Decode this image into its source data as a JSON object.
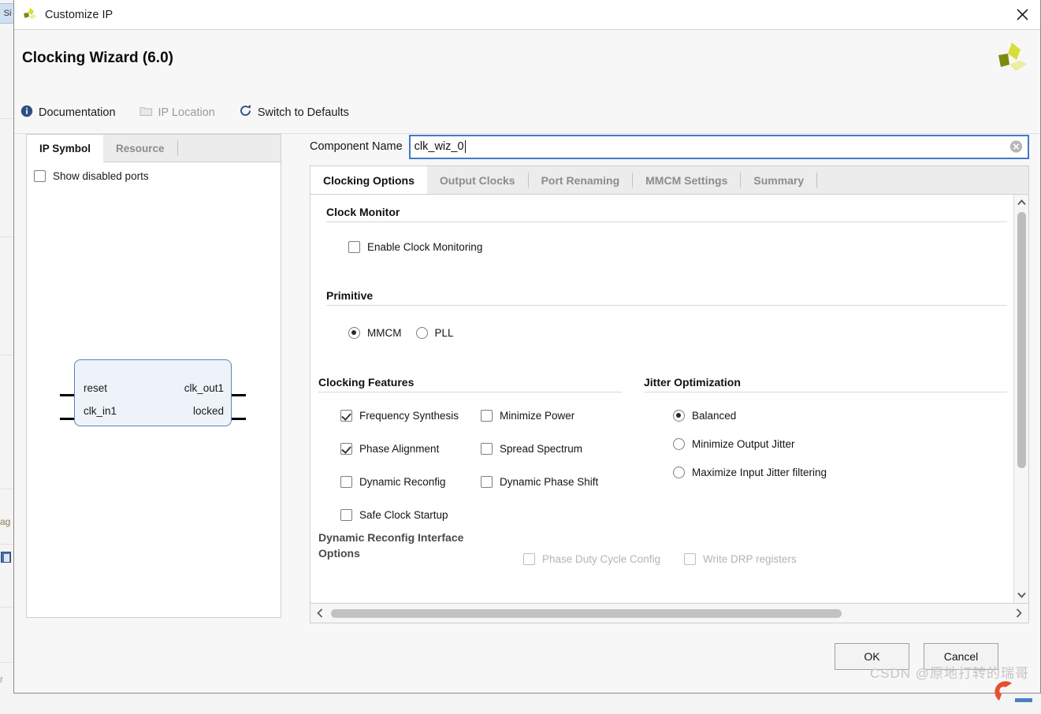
{
  "window": {
    "title": "Customize IP",
    "logo_icon": "xilinx-logo-icon",
    "close_icon": "close-icon"
  },
  "header": {
    "title": "Clocking Wizard (6.0)",
    "brand_logo_icon": "xilinx-logo-icon",
    "toolbar": [
      {
        "label": "Documentation",
        "icon": "info-icon",
        "disabled": false
      },
      {
        "label": "IP Location",
        "icon": "folder-icon",
        "disabled": true
      },
      {
        "label": "Switch to Defaults",
        "icon": "refresh-icon",
        "disabled": false
      }
    ]
  },
  "left_panel": {
    "tabs": [
      {
        "label": "IP Symbol",
        "active": true
      },
      {
        "label": "Resource",
        "active": false
      }
    ],
    "show_disabled_ports": {
      "label": "Show disabled ports",
      "checked": false
    },
    "symbol": {
      "inputs": [
        "reset",
        "clk_in1"
      ],
      "outputs": [
        "clk_out1",
        "locked"
      ]
    }
  },
  "component_name": {
    "label": "Component Name",
    "value": "clk_wiz_0",
    "placeholder": "component name",
    "clear_icon": "clear-circle-icon"
  },
  "tabs": [
    {
      "label": "Clocking Options",
      "active": true
    },
    {
      "label": "Output Clocks",
      "active": false
    },
    {
      "label": "Port Renaming",
      "active": false
    },
    {
      "label": "MMCM Settings",
      "active": false
    },
    {
      "label": "Summary",
      "active": false
    }
  ],
  "clocking_options": {
    "clock_monitor": {
      "title": "Clock Monitor",
      "enable": {
        "label": "Enable Clock Monitoring",
        "checked": false
      }
    },
    "primitive": {
      "title": "Primitive",
      "options": [
        {
          "label": "MMCM",
          "selected": true
        },
        {
          "label": "PLL",
          "selected": false
        }
      ]
    },
    "clocking_features": {
      "title": "Clocking Features",
      "column_left": [
        {
          "label": "Frequency Synthesis",
          "checked": true
        },
        {
          "label": "Phase Alignment",
          "checked": true
        },
        {
          "label": "Dynamic Reconfig",
          "checked": false
        },
        {
          "label": "Safe Clock Startup",
          "checked": false
        }
      ],
      "column_right": [
        {
          "label": "Minimize Power",
          "checked": false
        },
        {
          "label": "Spread Spectrum",
          "checked": false
        },
        {
          "label": "Dynamic Phase Shift",
          "checked": false
        }
      ]
    },
    "jitter_optimization": {
      "title": "Jitter Optimization",
      "options": [
        {
          "label": "Balanced",
          "selected": true
        },
        {
          "label": "Minimize Output Jitter",
          "selected": false
        },
        {
          "label": "Maximize Input Jitter filtering",
          "selected": false
        }
      ]
    },
    "dynamic_reconfig_interface": {
      "title_line1": "Dynamic Reconfig Interface",
      "title_line2": "Options",
      "options": [
        {
          "label": "Phase Duty Cycle Config",
          "checked": false
        },
        {
          "label": "Write DRP registers",
          "checked": false
        }
      ]
    }
  },
  "footer": {
    "ok_label": "OK",
    "cancel_label": "Cancel"
  },
  "watermark": {
    "text": "CSDN @原地打转的瑞哥"
  },
  "background": {
    "tab_label": "Si",
    "fragment_text": "ag",
    "fragment_text2": "r"
  }
}
